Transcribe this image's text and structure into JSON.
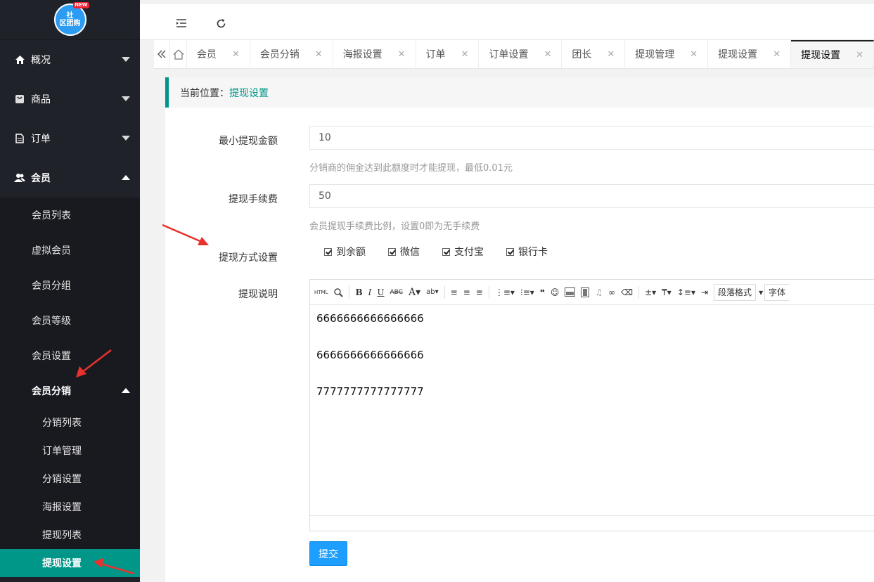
{
  "logo": {
    "badge_line1": "社",
    "badge_line2": "区团购",
    "badge_new": "NEW"
  },
  "sidebar": {
    "overview": "概况",
    "goods": "商品",
    "order": "订单",
    "member": "会员",
    "member_sub": [
      "会员列表",
      "虚拟会员",
      "会员分组",
      "会员等级",
      "会员设置"
    ],
    "distribution": "会员分销",
    "distribution_sub": [
      "分销列表",
      "订单管理",
      "分销设置",
      "海报设置",
      "提现列表",
      "提现设置"
    ]
  },
  "tabs": [
    {
      "label": "会员"
    },
    {
      "label": "会员分销"
    },
    {
      "label": "海报设置"
    },
    {
      "label": "订单"
    },
    {
      "label": "订单设置"
    },
    {
      "label": "团长"
    },
    {
      "label": "提现管理"
    },
    {
      "label": "提现设置"
    },
    {
      "label": "提现设置"
    }
  ],
  "breadcrumb": {
    "prefix": "当前位置：",
    "current": "提现设置"
  },
  "form": {
    "min_amount_label": "最小提现金额",
    "min_amount_value": "10",
    "min_amount_help": "分销商的佣金达到此额度时才能提现，最低0.01元",
    "fee_label": "提现手续费",
    "fee_value": "50",
    "fee_help": "会员提现手续费比例，设置0即为无手续费",
    "method_label": "提现方式设置",
    "methods": [
      "到余额",
      "微信",
      "支付宝",
      "银行卡"
    ],
    "desc_label": "提现说明",
    "editor_lines": [
      "6666666666666666",
      "6666666666666666",
      "7777777777777777"
    ],
    "toolbar": {
      "html": "HTML",
      "para_format": "段落格式",
      "font": "字体"
    },
    "submit": "提交"
  },
  "colors": {
    "accent": "#009688",
    "primary": "#1e9fff",
    "sidebar": "#20222a",
    "arrow": "#e8322d"
  }
}
